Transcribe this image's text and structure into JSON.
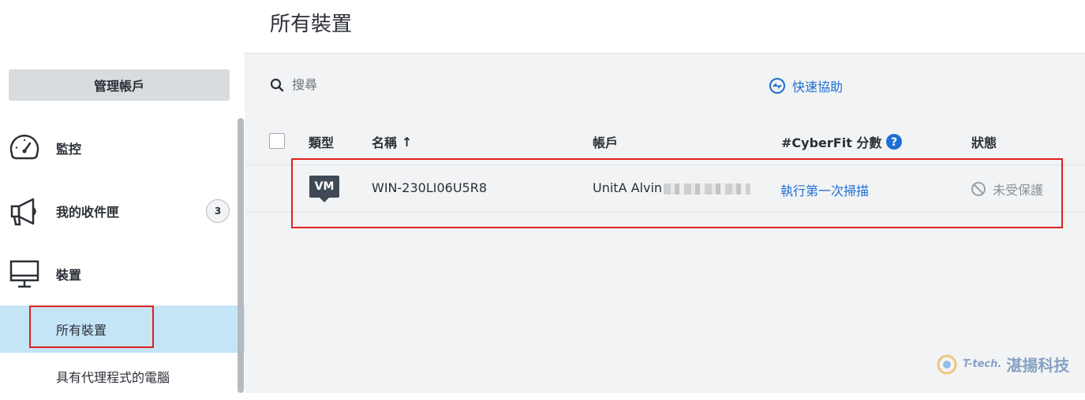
{
  "header": {
    "title": "所有裝置"
  },
  "sidebar": {
    "manage_account": "管理帳戶",
    "items": [
      {
        "label": "監控",
        "icon": "gauge-icon"
      },
      {
        "label": "我的收件匣",
        "icon": "megaphone-icon",
        "badge": "3"
      },
      {
        "label": "裝置",
        "icon": "monitor-icon"
      }
    ],
    "sub_items": [
      {
        "label": "所有裝置",
        "active": true
      },
      {
        "label": "具有代理程式的電腦",
        "active": false
      }
    ]
  },
  "toolbar": {
    "search_placeholder": "搜尋",
    "quick_assist": "快速協助"
  },
  "table": {
    "columns": [
      "類型",
      "名稱",
      "帳戶",
      "#CyberFit 分數",
      "狀態"
    ],
    "sort_indicator": "↑",
    "rows": [
      {
        "type": "VM",
        "name": "WIN-230LI06U5R8",
        "account": "UnitA Alvin",
        "cyberfit": "執行第一次掃描",
        "status": "未受保護"
      }
    ]
  },
  "watermark": {
    "brand": "T-tech.",
    "name": "湛揚科技"
  },
  "colors": {
    "accent": "#1f6fd1",
    "active_bg": "#c5e4f6",
    "highlight": "#e02020"
  }
}
